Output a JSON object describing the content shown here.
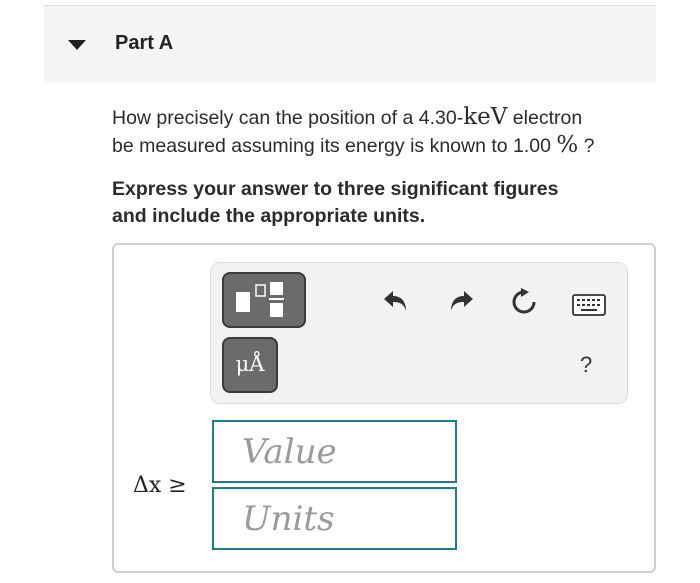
{
  "part": {
    "title": "Part A"
  },
  "question": {
    "text_1": "How precisely can the position of a 4.30-",
    "energy_unit": "keV",
    "text_2": " electron",
    "text_3": "be measured assuming its energy is known to 1.00 ",
    "percent": "%",
    "text_4": " ?"
  },
  "instructions": {
    "line_1": "Express your answer to three significant figures",
    "line_2": "and include the appropriate units."
  },
  "toolbar": {
    "units_button_label": "μÅ",
    "help_label": "?",
    "icons": [
      "templates-icon",
      "undo-icon",
      "redo-icon",
      "reset-icon",
      "keyboard-icon"
    ]
  },
  "answer": {
    "variable_label": "Δx ≥",
    "value_placeholder": "Value",
    "units_placeholder": "Units"
  },
  "colors": {
    "input_border": "#1b7f87",
    "tool_button": "#6b6b6b",
    "toolbar_bg": "#f2f2f2"
  }
}
